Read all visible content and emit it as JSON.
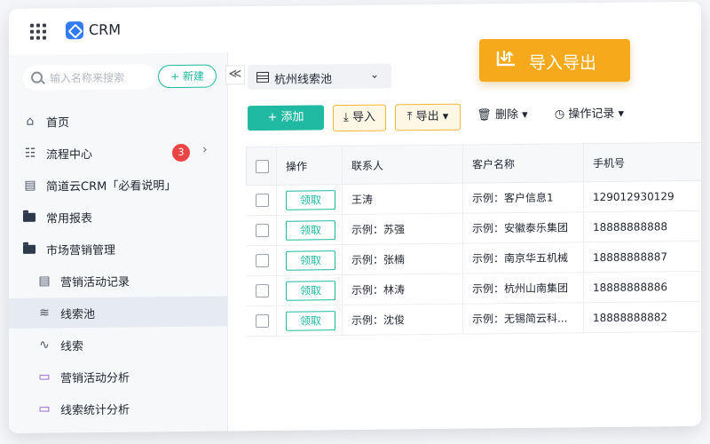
{
  "app": {
    "title": "CRM"
  },
  "sidebar": {
    "search_placeholder": "输入名称来搜索",
    "new_label": "+ 新建",
    "collapse": "≪",
    "items": [
      {
        "label": "首页"
      },
      {
        "label": "流程中心",
        "badge": "3"
      },
      {
        "label": "简道云CRM「必看说明」"
      },
      {
        "label": "常用报表"
      },
      {
        "label": "市场营销管理"
      },
      {
        "label": "营销活动记录"
      },
      {
        "label": "线索池"
      },
      {
        "label": "线索"
      },
      {
        "label": "营销活动分析"
      },
      {
        "label": "线索统计分析"
      }
    ]
  },
  "view": {
    "name": "杭州线索池"
  },
  "toolbar": {
    "add": "+ 添加",
    "import": "导入",
    "export": "导出",
    "delete": "删除",
    "log": "操作记录"
  },
  "import_export_badge": "导入导出",
  "table": {
    "headers": [
      "操作",
      "联系人",
      "客户名称",
      "手机号"
    ],
    "claim_label": "领取",
    "rows": [
      {
        "contact": "王涛",
        "customer": "示例：客户信息1",
        "phone": "129012930129"
      },
      {
        "contact": "示例：苏强",
        "customer": "示例：安徽泰乐集团",
        "phone": "18888888888"
      },
      {
        "contact": "示例：张楠",
        "customer": "示例：南京华五机械",
        "phone": "18888888887"
      },
      {
        "contact": "示例：林涛",
        "customer": "示例：杭州山南集团",
        "phone": "18888888886"
      },
      {
        "contact": "示例：沈俊",
        "customer": "示例：无锡简云科...",
        "phone": "18888888882"
      }
    ]
  },
  "colors": {
    "accent": "#20b9a1",
    "warning": "#f6a91a",
    "badge": "#e94545",
    "brand": "#2f7cf6"
  }
}
